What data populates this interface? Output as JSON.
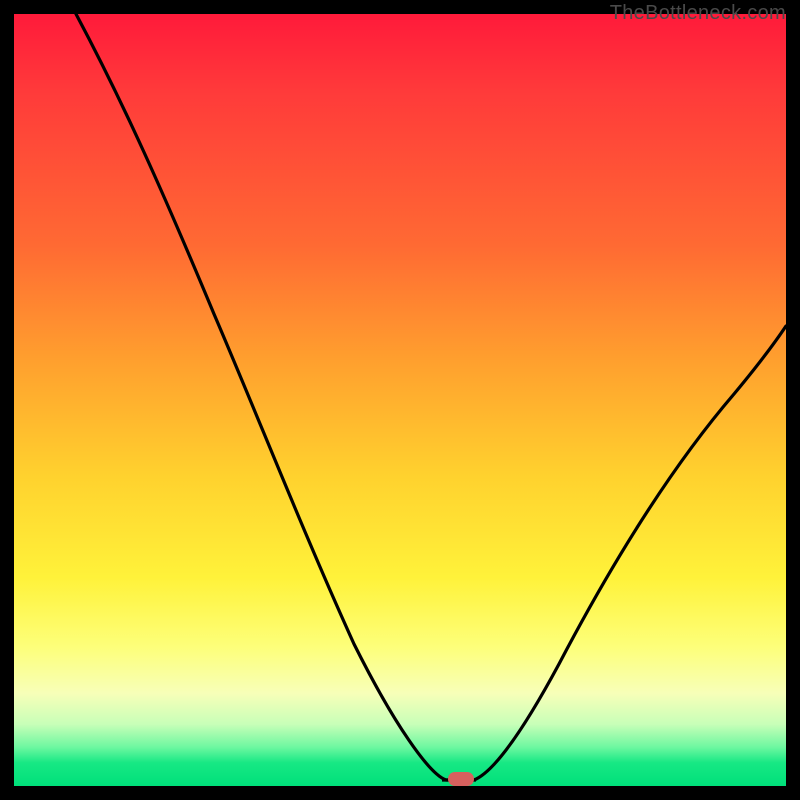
{
  "watermark": "TheBottleneck.com",
  "colors": {
    "background": "#000000",
    "curve": "#000000",
    "marker": "#d6605e"
  },
  "chart_data": {
    "type": "line",
    "title": "",
    "xlabel": "",
    "ylabel": "",
    "xlim": [
      0,
      100
    ],
    "ylim": [
      0,
      100
    ],
    "grid": false,
    "legend": false,
    "series": [
      {
        "name": "curve",
        "x": [
          8,
          15,
          22,
          28,
          34,
          40,
          45,
          49,
          52,
          54,
          56,
          58,
          60,
          64,
          70,
          78,
          86,
          94,
          100
        ],
        "y": [
          100,
          86,
          73,
          62,
          51,
          40,
          30,
          20,
          12,
          6,
          2,
          0.5,
          0.5,
          4,
          12,
          26,
          40,
          52,
          60
        ]
      }
    ],
    "marker": {
      "x": 58,
      "y": 0.5
    },
    "gradient_stops": [
      {
        "pos": 0.0,
        "color": "#ff1a3a"
      },
      {
        "pos": 0.3,
        "color": "#ff6a33"
      },
      {
        "pos": 0.6,
        "color": "#ffd22e"
      },
      {
        "pos": 0.85,
        "color": "#fdff7a"
      },
      {
        "pos": 1.0,
        "color": "#00e07a"
      }
    ]
  }
}
